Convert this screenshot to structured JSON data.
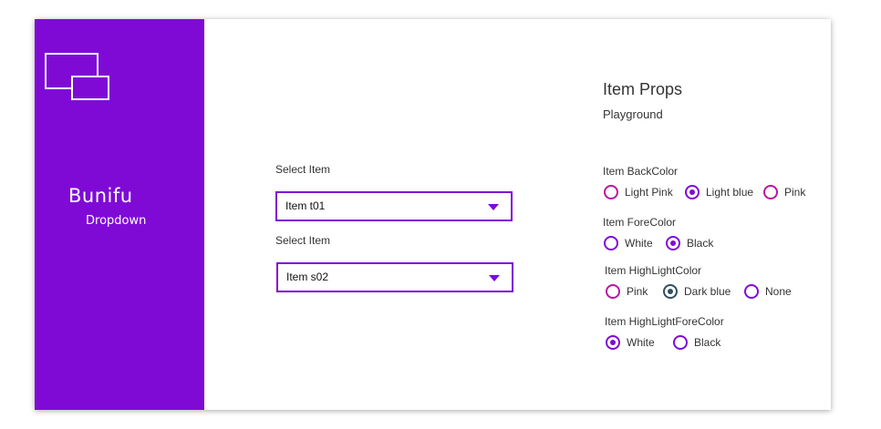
{
  "brand": {
    "name": "Bunifu",
    "subtitle": "Dropdown"
  },
  "dropdowns": [
    {
      "label": "Select Item",
      "value": "Item t01"
    },
    {
      "label": "Select Item",
      "value": "Item s02"
    }
  ],
  "props": {
    "title": "Item Props",
    "subtitle": "Playground",
    "groups": [
      {
        "label": "Item BackColor",
        "options": [
          {
            "label": "Light Pink",
            "checked": false,
            "color": "#b5179e"
          },
          {
            "label": "Light blue",
            "checked": true,
            "color": "#7f0ad6"
          },
          {
            "label": "Pink",
            "checked": false,
            "color": "#b5179e"
          }
        ]
      },
      {
        "label": "Item ForeColor",
        "options": [
          {
            "label": "White",
            "checked": false,
            "color": "#7f0ad6"
          },
          {
            "label": "Black",
            "checked": true,
            "color": "#7f0ad6"
          }
        ]
      },
      {
        "label": "Item HighLightColor",
        "options": [
          {
            "label": "Pink",
            "checked": false,
            "color": "#b5179e"
          },
          {
            "label": "Dark blue",
            "checked": true,
            "color": "#2f4f5f"
          },
          {
            "label": "None",
            "checked": false,
            "color": "#7f0ad6"
          }
        ]
      },
      {
        "label": "Item HighLightForeColor",
        "options": [
          {
            "label": "White",
            "checked": true,
            "color": "#7f0ad6"
          },
          {
            "label": "Black",
            "checked": false,
            "color": "#7f0ad6"
          }
        ]
      }
    ]
  },
  "colors": {
    "accent": "#7f0ad6",
    "pink": "#b5179e",
    "dark_blue": "#2f4f5f"
  }
}
